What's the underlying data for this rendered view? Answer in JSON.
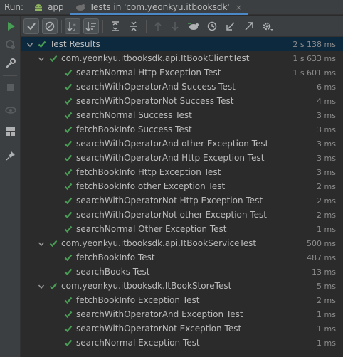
{
  "runbar": {
    "label": "Run:",
    "tabs": [
      {
        "label": "app",
        "icon": "android-icon",
        "active": false
      },
      {
        "label": "Tests in 'com.yeonkyu.itbooksdk'",
        "icon": "test-icon",
        "active": true
      }
    ],
    "close_glyph": "×"
  },
  "toolbar": {
    "buttons": [
      "show-passed-icon",
      "show-ignored-icon",
      "sort-alpha-icon",
      "sort-duration-icon",
      "expand-all-icon",
      "collapse-all-icon",
      "prev-failed-icon",
      "next-failed-icon",
      "import-tests-icon",
      "history-icon",
      "export-icon",
      "open-icon",
      "settings-icon"
    ]
  },
  "colors": {
    "accent": "#4a88c7",
    "pass": "#499c54",
    "selected": "#0d293e"
  },
  "tree": {
    "root": {
      "name": "Test Results",
      "duration": "2 s 138 ms"
    },
    "suites": [
      {
        "name": "com.yeonkyu.itbooksdk.api.ItBookClientTest",
        "duration": "1 s 633 ms",
        "tests": [
          {
            "name": "searchNormal Http Exception Test",
            "duration": "1 s 601 ms"
          },
          {
            "name": "searchWithOperatorAnd Success Test",
            "duration": "6 ms"
          },
          {
            "name": "searchWithOperatorNot Success Test",
            "duration": "4 ms"
          },
          {
            "name": "searchNormal Success Test",
            "duration": "3 ms"
          },
          {
            "name": "fetchBookInfo Success Test",
            "duration": "3 ms"
          },
          {
            "name": "searchWithOperatorAnd other Exception Test",
            "duration": "3 ms"
          },
          {
            "name": "searchWithOperatorAnd Http Exception Test",
            "duration": "3 ms"
          },
          {
            "name": "fetchBookInfo Http Exception Test",
            "duration": "3 ms"
          },
          {
            "name": "fetchBookInfo other Exception Test",
            "duration": "2 ms"
          },
          {
            "name": "searchWithOperatorNot Http Exception Test",
            "duration": "2 ms"
          },
          {
            "name": "searchWithOperatorNot other Exception Test",
            "duration": "2 ms"
          },
          {
            "name": "searchNormal Other Exception Test",
            "duration": "1 ms"
          }
        ]
      },
      {
        "name": "com.yeonkyu.itbooksdk.api.ItBookServiceTest",
        "duration": "500 ms",
        "tests": [
          {
            "name": "fetchBookInfo Test",
            "duration": "487 ms"
          },
          {
            "name": "searchBooks Test",
            "duration": "13 ms"
          }
        ]
      },
      {
        "name": "com.yeonkyu.itbooksdk.ItBookStoreTest",
        "duration": "5 ms",
        "tests": [
          {
            "name": "fetchBookInfo Exception Test",
            "duration": "2 ms"
          },
          {
            "name": "searchWithOperatorAnd Exception Test",
            "duration": "1 ms"
          },
          {
            "name": "searchWithOperatorNot Exception Test",
            "duration": "1 ms"
          },
          {
            "name": "searchNormal Exception Test",
            "duration": "1 ms"
          }
        ]
      }
    ]
  }
}
